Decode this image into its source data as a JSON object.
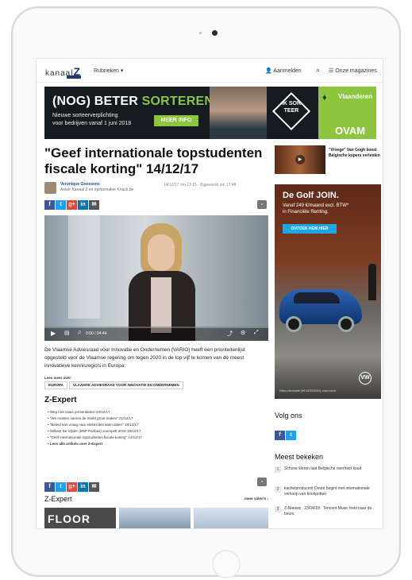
{
  "header": {
    "logo_text": "kanaal",
    "logo_letter": "Z",
    "menu_label": "Rubrieken ▾",
    "login_label": "Aanmelden",
    "magazines_label": "Onze magazines"
  },
  "banner": {
    "headline_a": "(NOG) BETER ",
    "headline_b": "SORTEREN?",
    "line1": "Nieuwe sorteerverplichting",
    "line2": "voor bedrijven vanaf 1 juni 2018",
    "button": "MEER INFO",
    "badge": "IK SOR TEER",
    "org_region": "Vlaanderen",
    "org_name": "OVAM"
  },
  "article": {
    "title": "\"Geef internationale topstudenten fiscale korting\" 14/12/17",
    "author_name": "Veronique Goossens",
    "author_role": "Anker Kanaal Z en opiniemaker Knack.be",
    "date": "14/12/17 om 13:15 - Bijgewerkt om 17:48",
    "body": "De Vlaamse Adviesraad voor Innovatie en Ondernemen (VARIO) heeft een prioriteitenlijst opgesteld voor de Vlaamse regering om tegen 2020 in de top vijf te komen van de meest innovatieve kennisregio's in Europa.",
    "read_more_label": "Lees meer over:",
    "tags": [
      "EUROPA",
      "VLAAMSE ADVIESRAAD VOOR INNOVATIE EN ONDERNEMEN"
    ]
  },
  "video": {
    "time": "0:00 / 04:44"
  },
  "zexpert": {
    "heading": "Z-Expert",
    "items": [
      "Weg met saaie presentaties! 23/12/17",
      "\"We moeten samen de markt groot maken\" 21/12/17",
      "\"Beleid kan vraag naar elektriciteit laten dalen\" 19/12/17",
      "William De Vijlder (BNP Paribas) voorspelt 2018 18/12/17",
      "\"Geef internationale topstudenten fiscale korting\" 14/12/17",
      "Lees alle artikels over Z-Expert"
    ],
    "heading2": "Z-Expert",
    "more_link": "meer video's ›",
    "thumb1_text": "FLOOR"
  },
  "sidebar": {
    "teaser": "\"Vroege\" Van Gogh koest Belgische kopers verleiden",
    "ad_title": "De Golf JOIN.",
    "ad_line1": "Vanaf 249 €/maand excl. BTW*",
    "ad_line2": "in Financiële Renting.",
    "ad_button": "ONTDEK HEM HIER",
    "ad_brand": "VW",
    "ad_footer": "Milieu-informatie (KB 19/03/2004): www.vw.be",
    "follow_heading": "Volg ons",
    "most_read_heading": "Meest bekeken",
    "most_read": [
      {
        "num": "1",
        "text": "Schone kleren laat Belgische overheid koud"
      },
      {
        "num": "2",
        "text": "kachelproducent Dovre begint met internationale verkoop van kookpotten"
      },
      {
        "num": "3",
        "text": "Z-Nieuws : 23/04/18 : Tencent Music trekt naar de beurs"
      }
    ]
  },
  "colors": {
    "accent_green": "#8cc63f",
    "facebook": "#3b5998",
    "twitter": "#1da1f2"
  }
}
